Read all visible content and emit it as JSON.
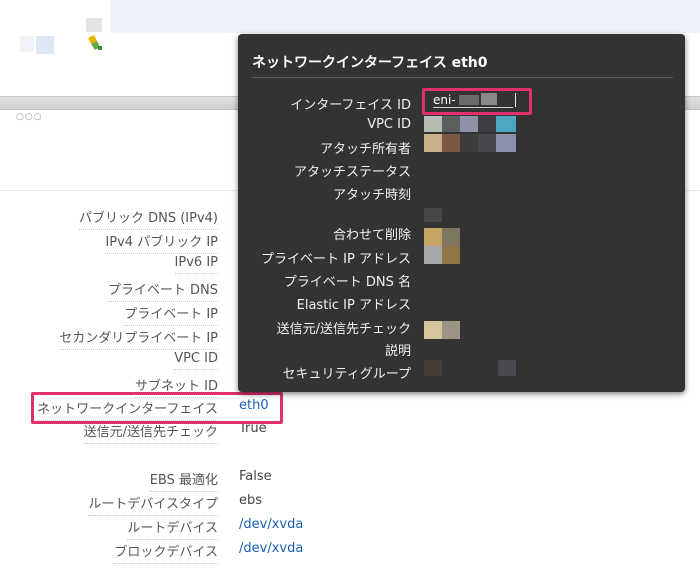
{
  "colors": {
    "highlight": "#e0306e",
    "popup_bg": "#333333",
    "link": "#1a5fb4"
  },
  "header": {
    "icon": "pencil-broom-icon"
  },
  "details": [
    {
      "label": "パブリック DNS (IPv4)",
      "value": ""
    },
    {
      "label": "IPv4 パブリック IP",
      "value": ""
    },
    {
      "label": "IPv6 IP",
      "value": ""
    },
    {
      "label": "プライベート DNS",
      "value": ""
    },
    {
      "label": "プライベート IP",
      "value": ""
    },
    {
      "label": "セカンダリプライベート IP",
      "value": ""
    },
    {
      "label": "VPC ID",
      "value": ""
    },
    {
      "label": "サブネット ID",
      "value": ""
    },
    {
      "label": "ネットワークインターフェイス",
      "value": "eth0"
    },
    {
      "label": "送信元/送信先チェック",
      "value": "True"
    },
    {
      "label": "EBS 最適化",
      "value": "False"
    },
    {
      "label": "ルートデバイスタイプ",
      "value": "ebs"
    },
    {
      "label": "ルートデバイス",
      "value": "/dev/xvda"
    },
    {
      "label": "ブロックデバイス",
      "value": "/dev/xvda"
    }
  ],
  "popup": {
    "title": "ネットワークインターフェイス eth0",
    "eni_value": "eni-",
    "fields": [
      "インターフェイス ID",
      "VPC ID",
      "アタッチ所有者",
      "アタッチステータス",
      "アタッチ時刻",
      "合わせて削除",
      "プライベート IP アドレス",
      "プライベート DNS 名",
      "Elastic IP アドレス",
      "送信元/送信先チェック",
      "説明",
      "セキュリティグループ"
    ]
  }
}
